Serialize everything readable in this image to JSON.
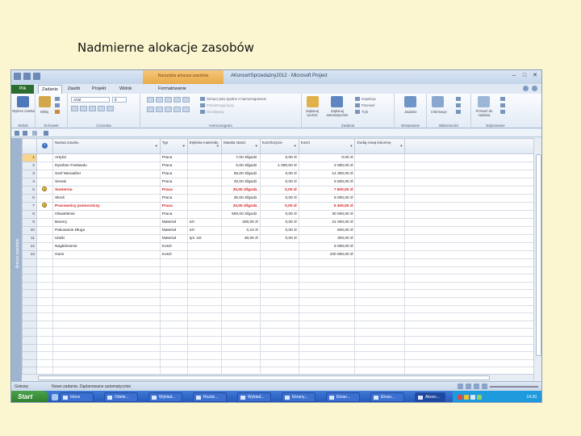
{
  "slide_title": "Nadmierne alokacje zasobów",
  "window": {
    "title": "AKoncertSprzedażny2012 - Microsoft Project",
    "context_tab": "Narzędzia arkusza zasobów"
  },
  "tabs": [
    {
      "label": "Plik",
      "active": false
    },
    {
      "label": "Zadanie",
      "active": true
    },
    {
      "label": "Zasób",
      "active": false
    },
    {
      "label": "Projekt",
      "active": false
    },
    {
      "label": "Widok",
      "active": false
    },
    {
      "label": "Formatowanie",
      "active": false
    }
  ],
  "ribbon": {
    "groups": [
      {
        "label": "Widok"
      },
      {
        "label": "Schowek"
      },
      {
        "label": "Czcionka"
      },
      {
        "label": "Harmonogram"
      },
      {
        "label": "Zadania"
      },
      {
        "label": "Wstawianie"
      },
      {
        "label": "Właściwości"
      },
      {
        "label": "Edytowanie"
      }
    ],
    "wykres_label": "Wykres Gantta",
    "wklej_label": "Wklej",
    "font_name": "Arial",
    "font_size": "8",
    "schedule_items": [
      "Oznacz jako zgodne z harmonogramem",
      "Przestrzegaj łączy",
      "Dezaktywuj"
    ],
    "task_mode_items": [
      "Zaplanuj ręcznie",
      "Zaplanuj automatycznie"
    ],
    "task_side_items": [
      "Inspekcja",
      "Przenieś",
      "Tryb"
    ],
    "insert_label": "Zadanie",
    "info_label": "Informacje",
    "scroll_label": "Przewiń do zadania"
  },
  "table": {
    "headers": {
      "indicators": "i",
      "name": "Nazwa zasobu",
      "type": "Typ",
      "material_label": "Etykieta materiału",
      "std_rate": "Stawka stand.",
      "cost_per_use": "Koszt/użycie",
      "cost": "Koszt",
      "add_column": "Dodaj nową kolumnę"
    },
    "rows": [
      {
        "id": "1",
        "name": "Artyści",
        "type": "Praca",
        "label": "",
        "rate": "7,00 zł/godz.",
        "per_use": "0,00 zł",
        "cost": "0,00 zł",
        "over": false,
        "warn": false
      },
      {
        "id": "2",
        "name": "Dyrektor Festiwalu",
        "type": "Praca",
        "label": "",
        "rate": "0,00 zł/godz.",
        "per_use": "1 000,00 zł",
        "cost": "2 000,00 zł",
        "over": false,
        "warn": false
      },
      {
        "id": "3",
        "name": "Szef Menadżer",
        "type": "Praca",
        "label": "",
        "rate": "55,00 zł/godz.",
        "per_use": "0,00 zł",
        "cost": "14 300,00 zł",
        "over": false,
        "warn": false
      },
      {
        "id": "4",
        "name": "Serwis",
        "type": "Praca",
        "label": "",
        "rate": "40,00 zł/godz.",
        "per_use": "0,00 zł",
        "cost": "5 600,00 zł",
        "over": false,
        "warn": false
      },
      {
        "id": "5",
        "name": "Sumersia",
        "type": "Praca",
        "label": "",
        "rate": "30,00 zł/godz.",
        "per_use": "0,00 zł",
        "cost": "7 600,00 zł",
        "over": true,
        "warn": true
      },
      {
        "id": "6",
        "name": "Słooś",
        "type": "Praca",
        "label": "",
        "rate": "30,00 zł/godz.",
        "per_use": "0,00 zł",
        "cost": "6 000,00 zł",
        "over": false,
        "warn": false
      },
      {
        "id": "7",
        "name": "Pracownicy pomocniczy",
        "type": "Praca",
        "label": "",
        "rate": "20,00 zł/godz.",
        "per_use": "0,00 zł",
        "cost": "6 400,00 zł",
        "over": true,
        "warn": true
      },
      {
        "id": "8",
        "name": "Oświetlenie",
        "type": "Praca",
        "label": "",
        "rate": "500,00 zł/godz.",
        "per_use": "0,00 zł",
        "cost": "30 000,00 zł",
        "over": false,
        "warn": false
      },
      {
        "id": "9",
        "name": "Banery",
        "type": "Materiał",
        "label": "szt",
        "rate": "300,00 zł",
        "per_use": "0,00 zł",
        "cost": "21 000,00 zł",
        "over": false,
        "warn": false
      },
      {
        "id": "10",
        "name": "Pakowanie Długo",
        "type": "Materiał",
        "label": "szt",
        "rate": "0,10 zł",
        "per_use": "0,00 zł",
        "cost": "500,00 zł",
        "over": false,
        "warn": false
      },
      {
        "id": "11",
        "name": "Ulotki",
        "type": "Materiał",
        "label": "tys. szt",
        "rate": "30,00 zł",
        "per_use": "0,00 zł",
        "cost": "300,00 zł",
        "over": false,
        "warn": false
      },
      {
        "id": "12",
        "name": "Nagłośnienie",
        "type": "Koszt",
        "label": "",
        "rate": "",
        "per_use": "",
        "cost": "5 000,00 zł",
        "over": false,
        "warn": false
      },
      {
        "id": "13",
        "name": "Gaże",
        "type": "Koszt",
        "label": "",
        "rate": "",
        "per_use": "",
        "cost": "100 000,00 zł",
        "over": false,
        "warn": false
      }
    ],
    "empty_rows": 15
  },
  "sidebar_label": "Arkusz zasobów",
  "status": {
    "ready": "Gotowy",
    "mode": "Nowe zadania: Zaplanowane automatycznie"
  },
  "taskbar": {
    "start_label": "Start",
    "clock": "14:30",
    "tasks": [
      {
        "label": "Inbox",
        "active": false
      },
      {
        "label": "Odebr...",
        "active": false
      },
      {
        "label": "Wykład...",
        "active": false
      },
      {
        "label": "Rozdz...",
        "active": false
      },
      {
        "label": "Wykład...",
        "active": false
      },
      {
        "label": "Ekrany...",
        "active": false
      },
      {
        "label": "Ekran...",
        "active": false
      },
      {
        "label": "Ekran...",
        "active": false
      },
      {
        "label": "Akonc...",
        "active": true
      }
    ]
  },
  "colors": {
    "overallocated": "#d11f1f",
    "file_tab": "#2a6d2f",
    "taskbar": "#2255b8"
  }
}
